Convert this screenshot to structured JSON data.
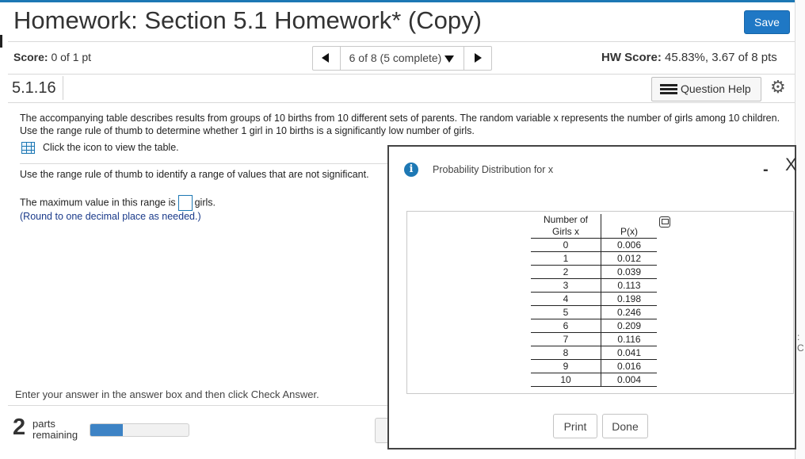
{
  "header": {
    "title": "Homework: Section 5.1 Homework* (Copy)",
    "save_label": "Save"
  },
  "score_bar": {
    "score_label": "Score:",
    "score_value": "0 of 1 pt",
    "nav_label": "6 of 8 (5 complete)",
    "hw_score_label": "HW Score:",
    "hw_score_value": "45.83%, 3.67 of 8 pts"
  },
  "question_bar": {
    "number": "5.1.16",
    "help_label": "Question Help"
  },
  "question": {
    "text": "The accompanying table describes results from groups of 10 births from 10 different sets of parents. The random variable x represents the number of girls among 10 children. Use the range rule of thumb to determine whether 1 girl in 10 births is a significantly low number of girls.",
    "table_link": "Click the icon to view the table.",
    "instruction": "Use the range rule of thumb to identify a range of values that are not significant.",
    "answer_prefix": "The maximum value in this range is",
    "answer_suffix": "girls.",
    "round_note": "(Round to one decimal place as needed.)"
  },
  "footer": {
    "enter_note": "Enter your answer in the answer box and then click Check Answer.",
    "parts_count": "2",
    "parts_label_1": "parts",
    "parts_label_2": "remaining",
    "progress_fraction": 0.33
  },
  "modal": {
    "title": "Probability Distribution for x",
    "minimize": "-",
    "close": "X",
    "table": {
      "header_1_line1": "Number of",
      "header_1_line2": "Girls x",
      "header_2": "P(x)",
      "rows": [
        {
          "x": "0",
          "p": "0.006"
        },
        {
          "x": "1",
          "p": "0.012"
        },
        {
          "x": "2",
          "p": "0.039"
        },
        {
          "x": "3",
          "p": "0.113"
        },
        {
          "x": "4",
          "p": "0.198"
        },
        {
          "x": "5",
          "p": "0.246"
        },
        {
          "x": "6",
          "p": "0.209"
        },
        {
          "x": "7",
          "p": "0.116"
        },
        {
          "x": "8",
          "p": "0.041"
        },
        {
          "x": "9",
          "p": "0.016"
        },
        {
          "x": "10",
          "p": "0.004"
        }
      ]
    },
    "print_label": "Print",
    "done_label": "Done"
  },
  "colors": {
    "accent": "#1d78b4",
    "save_button": "#1f78c5",
    "progress": "#3d83c5",
    "note_text": "#1a3a8a"
  },
  "icons": {
    "prev": "triangle-left",
    "next": "triangle-right",
    "dropdown": "triangle-down",
    "help": "list-icon",
    "settings": "gear-icon",
    "table": "grid-icon",
    "info": "info-icon",
    "copy": "copy-icon"
  }
}
